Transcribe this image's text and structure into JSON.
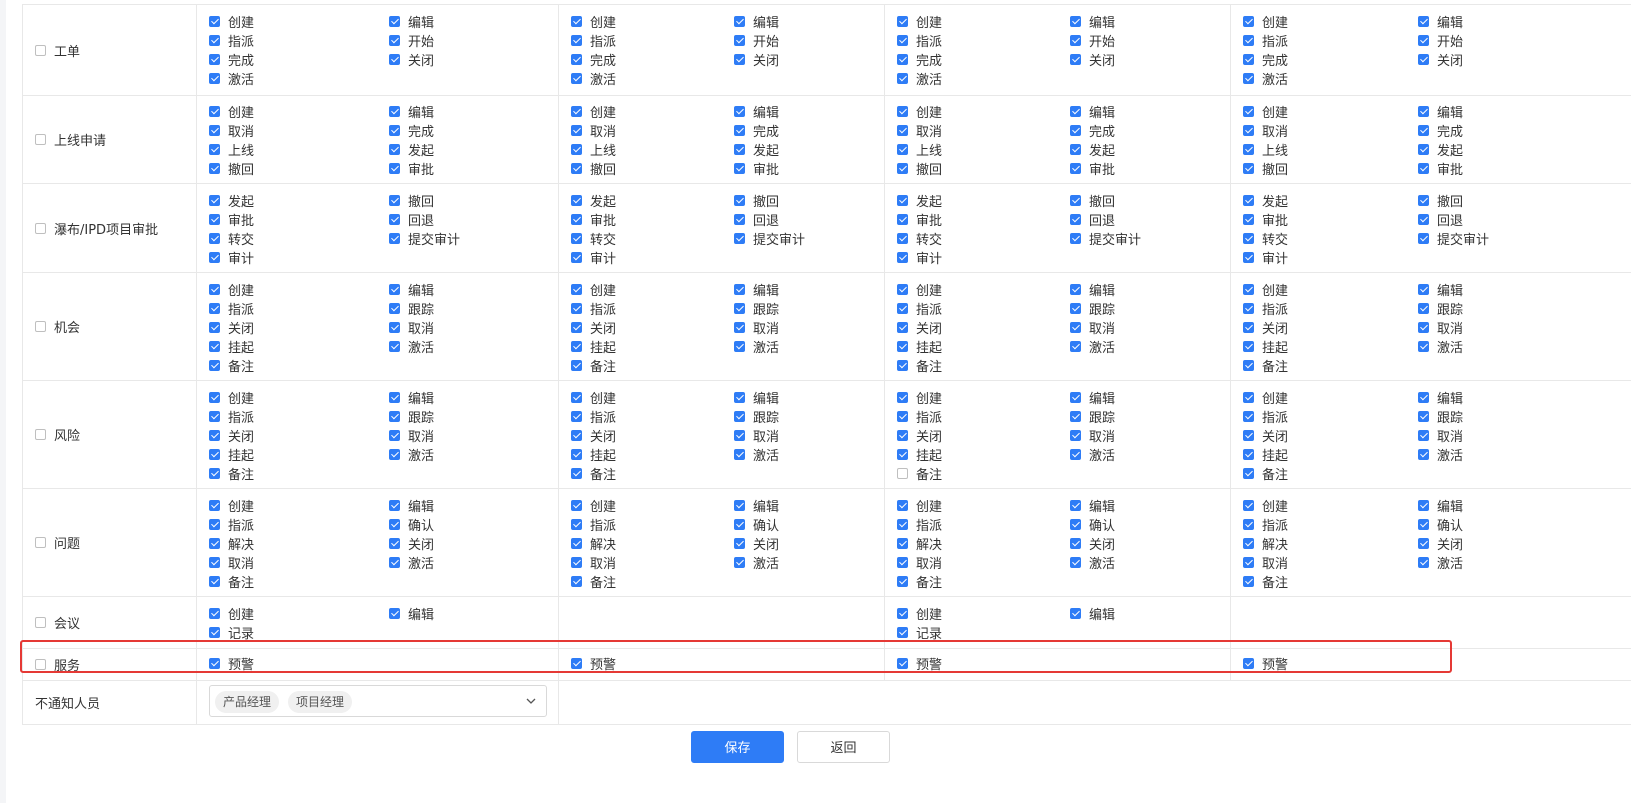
{
  "rows": [
    {
      "name": "工单",
      "columns": [
        [
          [
            "创建",
            1
          ],
          [
            "编辑",
            1
          ],
          [
            "指派",
            1
          ],
          [
            "开始",
            1
          ],
          [
            "完成",
            1
          ],
          [
            "关闭",
            1
          ],
          [
            "激活",
            1
          ]
        ],
        [
          [
            "创建",
            1
          ],
          [
            "编辑",
            1
          ],
          [
            "指派",
            1
          ],
          [
            "开始",
            1
          ],
          [
            "完成",
            1
          ],
          [
            "关闭",
            1
          ],
          [
            "激活",
            1
          ]
        ],
        [
          [
            "创建",
            1
          ],
          [
            "编辑",
            1
          ],
          [
            "指派",
            1
          ],
          [
            "开始",
            1
          ],
          [
            "完成",
            1
          ],
          [
            "关闭",
            1
          ],
          [
            "激活",
            1
          ]
        ],
        [
          [
            "创建",
            1
          ],
          [
            "编辑",
            1
          ],
          [
            "指派",
            1
          ],
          [
            "开始",
            1
          ],
          [
            "完成",
            1
          ],
          [
            "关闭",
            1
          ],
          [
            "激活",
            1
          ]
        ]
      ]
    },
    {
      "name": "上线申请",
      "columns": [
        [
          [
            "创建",
            1
          ],
          [
            "编辑",
            1
          ],
          [
            "取消",
            1
          ],
          [
            "完成",
            1
          ],
          [
            "上线",
            1
          ],
          [
            "发起",
            1
          ],
          [
            "撤回",
            1
          ],
          [
            "审批",
            1
          ]
        ],
        [
          [
            "创建",
            1
          ],
          [
            "编辑",
            1
          ],
          [
            "取消",
            1
          ],
          [
            "完成",
            1
          ],
          [
            "上线",
            1
          ],
          [
            "发起",
            1
          ],
          [
            "撤回",
            1
          ],
          [
            "审批",
            1
          ]
        ],
        [
          [
            "创建",
            1
          ],
          [
            "编辑",
            1
          ],
          [
            "取消",
            1
          ],
          [
            "完成",
            1
          ],
          [
            "上线",
            1
          ],
          [
            "发起",
            1
          ],
          [
            "撤回",
            1
          ],
          [
            "审批",
            1
          ]
        ],
        [
          [
            "创建",
            1
          ],
          [
            "编辑",
            1
          ],
          [
            "取消",
            1
          ],
          [
            "完成",
            1
          ],
          [
            "上线",
            1
          ],
          [
            "发起",
            1
          ],
          [
            "撤回",
            1
          ],
          [
            "审批",
            1
          ]
        ]
      ]
    },
    {
      "name": "瀑布/IPD项目审批",
      "columns": [
        [
          [
            "发起",
            1
          ],
          [
            "撤回",
            1
          ],
          [
            "审批",
            1
          ],
          [
            "回退",
            1
          ],
          [
            "转交",
            1
          ],
          [
            "提交审计",
            1
          ],
          [
            "审计",
            1
          ]
        ],
        [
          [
            "发起",
            1
          ],
          [
            "撤回",
            1
          ],
          [
            "审批",
            1
          ],
          [
            "回退",
            1
          ],
          [
            "转交",
            1
          ],
          [
            "提交审计",
            1
          ],
          [
            "审计",
            1
          ]
        ],
        [
          [
            "发起",
            1
          ],
          [
            "撤回",
            1
          ],
          [
            "审批",
            1
          ],
          [
            "回退",
            1
          ],
          [
            "转交",
            1
          ],
          [
            "提交审计",
            1
          ],
          [
            "审计",
            1
          ]
        ],
        [
          [
            "发起",
            1
          ],
          [
            "撤回",
            1
          ],
          [
            "审批",
            1
          ],
          [
            "回退",
            1
          ],
          [
            "转交",
            1
          ],
          [
            "提交审计",
            1
          ],
          [
            "审计",
            1
          ]
        ]
      ]
    },
    {
      "name": "机会",
      "columns": [
        [
          [
            "创建",
            1
          ],
          [
            "编辑",
            1
          ],
          [
            "指派",
            1
          ],
          [
            "跟踪",
            1
          ],
          [
            "关闭",
            1
          ],
          [
            "取消",
            1
          ],
          [
            "挂起",
            1
          ],
          [
            "激活",
            1
          ],
          [
            "备注",
            1
          ]
        ],
        [
          [
            "创建",
            1
          ],
          [
            "编辑",
            1
          ],
          [
            "指派",
            1
          ],
          [
            "跟踪",
            1
          ],
          [
            "关闭",
            1
          ],
          [
            "取消",
            1
          ],
          [
            "挂起",
            1
          ],
          [
            "激活",
            1
          ],
          [
            "备注",
            1
          ]
        ],
        [
          [
            "创建",
            1
          ],
          [
            "编辑",
            1
          ],
          [
            "指派",
            1
          ],
          [
            "跟踪",
            1
          ],
          [
            "关闭",
            1
          ],
          [
            "取消",
            1
          ],
          [
            "挂起",
            1
          ],
          [
            "激活",
            1
          ],
          [
            "备注",
            1
          ]
        ],
        [
          [
            "创建",
            1
          ],
          [
            "编辑",
            1
          ],
          [
            "指派",
            1
          ],
          [
            "跟踪",
            1
          ],
          [
            "关闭",
            1
          ],
          [
            "取消",
            1
          ],
          [
            "挂起",
            1
          ],
          [
            "激活",
            1
          ],
          [
            "备注",
            1
          ]
        ]
      ]
    },
    {
      "name": "风险",
      "columns": [
        [
          [
            "创建",
            1
          ],
          [
            "编辑",
            1
          ],
          [
            "指派",
            1
          ],
          [
            "跟踪",
            1
          ],
          [
            "关闭",
            1
          ],
          [
            "取消",
            1
          ],
          [
            "挂起",
            1
          ],
          [
            "激活",
            1
          ],
          [
            "备注",
            1
          ]
        ],
        [
          [
            "创建",
            1
          ],
          [
            "编辑",
            1
          ],
          [
            "指派",
            1
          ],
          [
            "跟踪",
            1
          ],
          [
            "关闭",
            1
          ],
          [
            "取消",
            1
          ],
          [
            "挂起",
            1
          ],
          [
            "激活",
            1
          ],
          [
            "备注",
            1
          ]
        ],
        [
          [
            "创建",
            1
          ],
          [
            "编辑",
            1
          ],
          [
            "指派",
            1
          ],
          [
            "跟踪",
            1
          ],
          [
            "关闭",
            1
          ],
          [
            "取消",
            1
          ],
          [
            "挂起",
            1
          ],
          [
            "激活",
            1
          ],
          [
            "备注",
            0
          ]
        ],
        [
          [
            "创建",
            1
          ],
          [
            "编辑",
            1
          ],
          [
            "指派",
            1
          ],
          [
            "跟踪",
            1
          ],
          [
            "关闭",
            1
          ],
          [
            "取消",
            1
          ],
          [
            "挂起",
            1
          ],
          [
            "激活",
            1
          ],
          [
            "备注",
            1
          ]
        ]
      ]
    },
    {
      "name": "问题",
      "columns": [
        [
          [
            "创建",
            1
          ],
          [
            "编辑",
            1
          ],
          [
            "指派",
            1
          ],
          [
            "确认",
            1
          ],
          [
            "解决",
            1
          ],
          [
            "关闭",
            1
          ],
          [
            "取消",
            1
          ],
          [
            "激活",
            1
          ],
          [
            "备注",
            1
          ]
        ],
        [
          [
            "创建",
            1
          ],
          [
            "编辑",
            1
          ],
          [
            "指派",
            1
          ],
          [
            "确认",
            1
          ],
          [
            "解决",
            1
          ],
          [
            "关闭",
            1
          ],
          [
            "取消",
            1
          ],
          [
            "激活",
            1
          ],
          [
            "备注",
            1
          ]
        ],
        [
          [
            "创建",
            1
          ],
          [
            "编辑",
            1
          ],
          [
            "指派",
            1
          ],
          [
            "确认",
            1
          ],
          [
            "解决",
            1
          ],
          [
            "关闭",
            1
          ],
          [
            "取消",
            1
          ],
          [
            "激活",
            1
          ],
          [
            "备注",
            1
          ]
        ],
        [
          [
            "创建",
            1
          ],
          [
            "编辑",
            1
          ],
          [
            "指派",
            1
          ],
          [
            "确认",
            1
          ],
          [
            "解决",
            1
          ],
          [
            "关闭",
            1
          ],
          [
            "取消",
            1
          ],
          [
            "激活",
            1
          ],
          [
            "备注",
            1
          ]
        ]
      ]
    },
    {
      "name": "会议",
      "columns": [
        [
          [
            "创建",
            1
          ],
          [
            "编辑",
            1
          ],
          [
            "记录",
            1
          ]
        ],
        [],
        [
          [
            "创建",
            1
          ],
          [
            "编辑",
            1
          ],
          [
            "记录",
            1
          ]
        ],
        []
      ]
    },
    {
      "name": "服务",
      "columns": [
        [
          [
            "预警",
            1
          ]
        ],
        [
          [
            "预警",
            1
          ]
        ],
        [
          [
            "预警",
            1
          ]
        ],
        [
          [
            "预警",
            1
          ]
        ]
      ]
    }
  ],
  "no_notify": {
    "label": "不通知人员",
    "tags": [
      "产品经理",
      "项目经理"
    ]
  },
  "buttons": {
    "save": "保存",
    "back": "返回"
  },
  "colors": {
    "accent": "#2e7cf6",
    "highlight": "#e53935"
  }
}
